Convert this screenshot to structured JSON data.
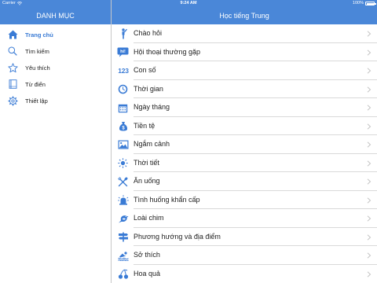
{
  "status_bar": {
    "carrier": "Carrier",
    "time": "9:24 AM",
    "battery": "100%"
  },
  "sidebar": {
    "title": "DANH MỤC",
    "items": [
      {
        "label": "Trang chủ",
        "icon": "home-icon",
        "active": true
      },
      {
        "label": "Tìm kiếm",
        "icon": "search-icon",
        "active": false
      },
      {
        "label": "Yêu thích",
        "icon": "star-icon",
        "active": false
      },
      {
        "label": "Từ điển",
        "icon": "book-icon",
        "active": false
      },
      {
        "label": "Thiết lập",
        "icon": "gear-icon",
        "active": false
      }
    ]
  },
  "main": {
    "title": "Học tiếng Trung",
    "categories": [
      {
        "label": "Chào hỏi",
        "icon": "person-waving-icon"
      },
      {
        "label": "Hội thoại thường gặp",
        "icon": "speech-bubble-icon",
        "icon_text": "hi!"
      },
      {
        "label": "Con số",
        "icon": "numbers-icon",
        "icon_text": "123"
      },
      {
        "label": "Thời gian",
        "icon": "clock-icon"
      },
      {
        "label": "Ngày tháng",
        "icon": "calendar-icon"
      },
      {
        "label": "Tiền tệ",
        "icon": "money-bag-icon"
      },
      {
        "label": "Ngắm cảnh",
        "icon": "landscape-picture-icon"
      },
      {
        "label": "Thời tiết",
        "icon": "sun-icon"
      },
      {
        "label": "Ăn uống",
        "icon": "utensils-icon"
      },
      {
        "label": "Tình huống khẩn cấp",
        "icon": "siren-icon"
      },
      {
        "label": "Loài chim",
        "icon": "bird-icon"
      },
      {
        "label": "Phương hướng và địa điểm",
        "icon": "signpost-icon"
      },
      {
        "label": "Sở thích",
        "icon": "swimmer-icon"
      },
      {
        "label": "Hoa quả",
        "icon": "cherries-icon"
      }
    ]
  },
  "colors": {
    "accent": "#4a87d8",
    "icon": "#3a7bd5",
    "separator": "#d9d9d9"
  }
}
